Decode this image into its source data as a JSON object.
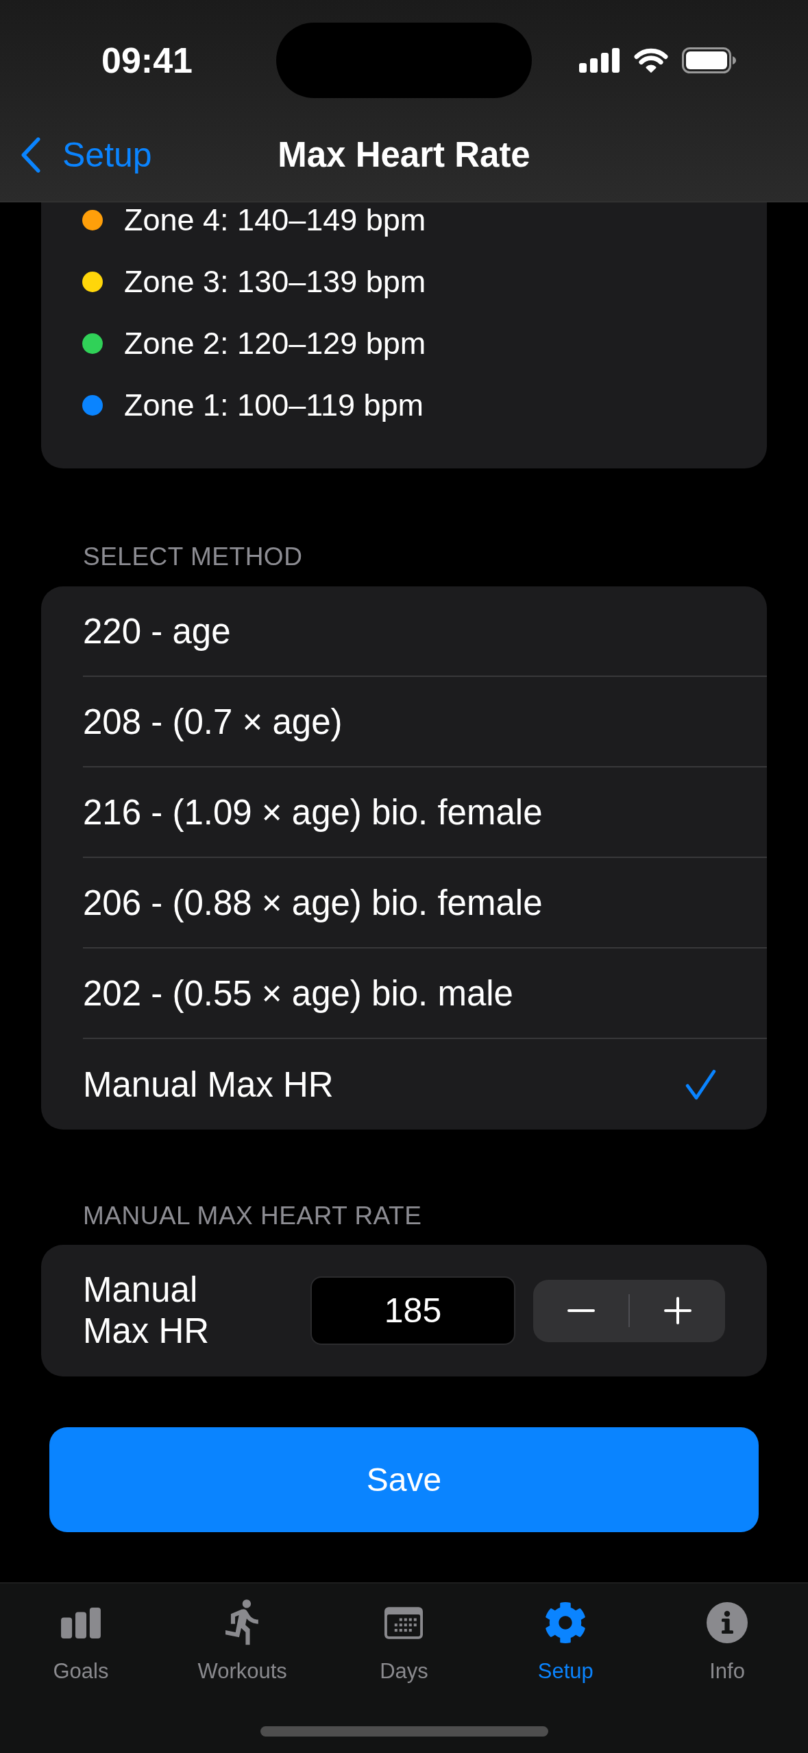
{
  "status_bar": {
    "time": "09:41"
  },
  "nav_bar": {
    "back_label": "Setup",
    "title": "Max Heart Rate"
  },
  "zones": [
    {
      "label": "Zone 4: 140–149 bpm",
      "color": "#ff9f0a"
    },
    {
      "label": "Zone 3: 130–139 bpm",
      "color": "#ffd60a"
    },
    {
      "label": "Zone 2: 120–129 bpm",
      "color": "#30d158"
    },
    {
      "label": "Zone 1: 100–119 bpm",
      "color": "#0a84ff"
    }
  ],
  "method_section": {
    "header": "SELECT METHOD",
    "options": [
      {
        "label": "220 - age",
        "selected": false
      },
      {
        "label": "208 - (0.7 × age)",
        "selected": false
      },
      {
        "label": "216 - (1.09 × age) bio. female",
        "selected": false
      },
      {
        "label": "206 - (0.88 × age) bio. female",
        "selected": false
      },
      {
        "label": "202 - (0.55 × age) bio. male",
        "selected": false
      },
      {
        "label": "Manual Max HR",
        "selected": true
      }
    ]
  },
  "manual_section": {
    "header": "MANUAL MAX HEART RATE",
    "label": "Manual Max HR",
    "value": "185"
  },
  "save_button": "Save",
  "tab_bar": [
    {
      "label": "Goals",
      "kind": "bars",
      "selected": false
    },
    {
      "label": "Workouts",
      "kind": "runner",
      "selected": false
    },
    {
      "label": "Days",
      "kind": "calendar",
      "selected": false
    },
    {
      "label": "Setup",
      "kind": "gear",
      "selected": true
    },
    {
      "label": "Info",
      "kind": "info",
      "selected": false
    }
  ]
}
